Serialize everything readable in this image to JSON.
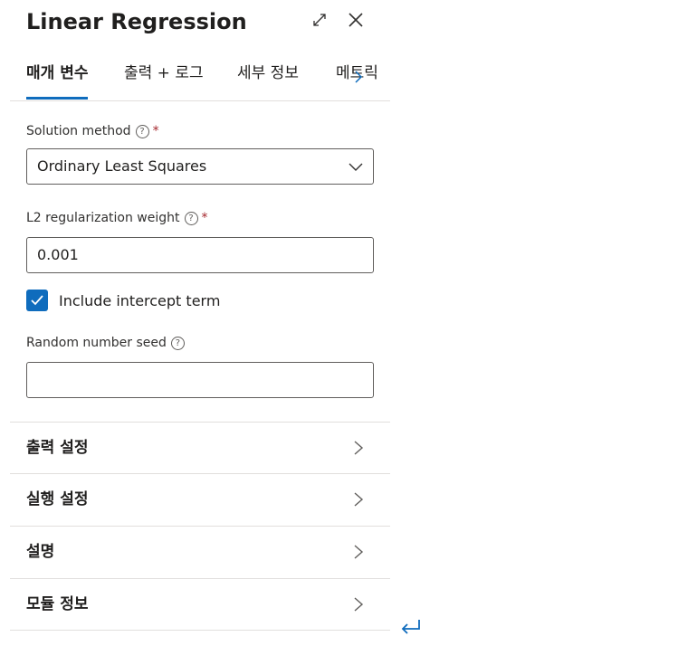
{
  "header": {
    "title": "Linear Regression",
    "expand_icon": "expand-icon",
    "close_icon": "close-icon"
  },
  "tabs": [
    {
      "label": "매개 변수",
      "active": true
    },
    {
      "label": "출력 + 로그",
      "active": false
    },
    {
      "label": "세부 정보",
      "active": false
    },
    {
      "label": "메트릭",
      "active": false
    }
  ],
  "form": {
    "solution_method": {
      "label": "Solution method",
      "required": "*",
      "value": "Ordinary Least Squares"
    },
    "l2_weight": {
      "label": "L2 regularization weight",
      "required": "*",
      "value": "0.001"
    },
    "intercept": {
      "label": "Include intercept term",
      "checked": true
    },
    "seed": {
      "label": "Random number seed",
      "value": ""
    },
    "help_glyph": "?"
  },
  "sections": [
    {
      "label": "출력 설정"
    },
    {
      "label": "실행 설정"
    },
    {
      "label": "설명"
    },
    {
      "label": "모듈 정보"
    }
  ],
  "colors": {
    "accent": "#0f6cbd",
    "divider": "#e1dfdd",
    "text": "#201f1e"
  }
}
